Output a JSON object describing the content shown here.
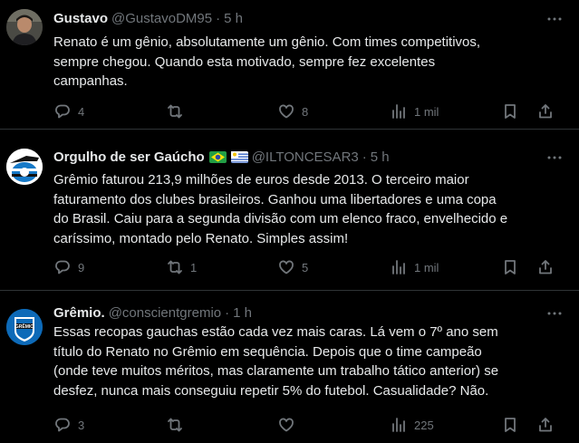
{
  "tweets": [
    {
      "name": "Gustavo",
      "handle": "@GustavoDM95",
      "sep": "·",
      "time": "5 h",
      "avatar_icon": "user-photo-avatar",
      "lines": [
        "Renato é um gênio, absolutamente um gênio. Com times competitivos,",
        "sempre chegou. Quando esta motivado, sempre fez excelentes",
        "campanhas."
      ],
      "counts": {
        "reply": "4",
        "retweet": "",
        "like": "8",
        "views": "1 mil"
      }
    },
    {
      "name": "Orgulho de ser Gaúcho",
      "handle": "@ILTONCESAR3",
      "sep": "·",
      "time": "5 h",
      "avatar_icon": "gremio-fan-avatar",
      "flags": [
        "brazil-flag-icon",
        "uruguay-flag-icon"
      ],
      "lines": [
        "Grêmio faturou 213,9 milhões de euros desde 2013. O terceiro maior",
        "faturamento dos clubes brasileiros. Ganhou uma libertadores e uma copa",
        "do Brasil. Caiu para a segunda divisão com um elenco fraco, envelhecido e",
        "caríssimo, montado pelo Renato. Simples assim!"
      ],
      "counts": {
        "reply": "9",
        "retweet": "1",
        "like": "5",
        "views": "1 mil"
      }
    },
    {
      "name": "Grêmio.",
      "handle": "@conscientgremio",
      "sep": "·",
      "time": "1 h",
      "avatar_icon": "gremio-crest-avatar",
      "avatar_text": "GRÊMIO",
      "lines": [
        "Essas recopas gauchas estão cada vez mais caras. Lá vem o 7º ano sem",
        "título do Renato no Grêmio em sequência. Depois que o time campeão",
        "(onde teve muitos méritos, mas claramente um trabalho tático anterior) se",
        "desfez, nunca mais conseguiu repetir 5% do futebol. Casualidade? Não."
      ],
      "counts": {
        "reply": "3",
        "retweet": "",
        "like": "",
        "views": "225"
      }
    }
  ],
  "colors": {
    "background": "#000000",
    "text": "#e7e9ea",
    "secondary": "#71767b",
    "divider": "#2f3336"
  }
}
